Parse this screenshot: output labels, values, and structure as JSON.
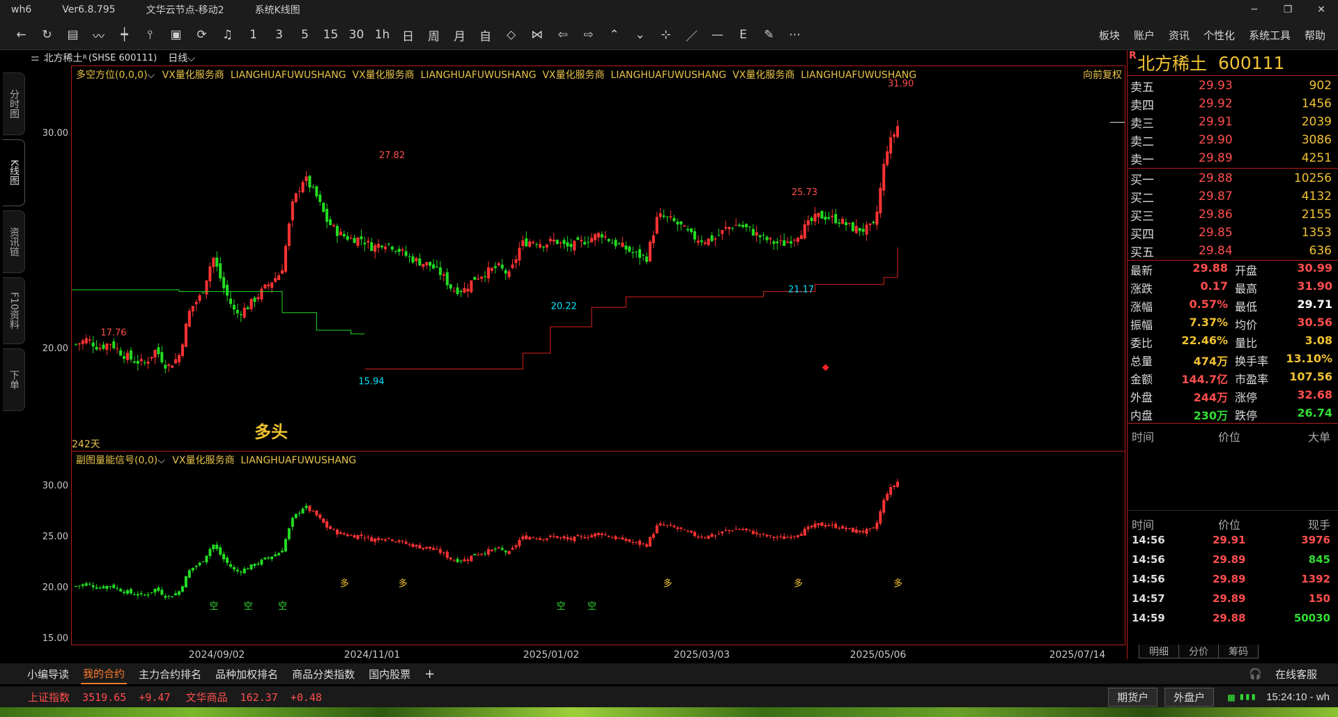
{
  "window": {
    "app": "wh6",
    "version": "Ver6.8.795",
    "node": "文华云节点-移动2",
    "view": "系统K线图",
    "controls": [
      "─",
      "❐",
      "✕"
    ]
  },
  "toolbar": {
    "icons": [
      {
        "name": "back-icon",
        "glyph": "←"
      },
      {
        "name": "refresh-icon",
        "glyph": "↻"
      },
      {
        "name": "table-icon",
        "glyph": "▤"
      },
      {
        "name": "line-chart-icon",
        "glyph": "〰"
      },
      {
        "name": "kline-icon",
        "glyph": "┿"
      },
      {
        "name": "candle-icon",
        "glyph": "⫯"
      },
      {
        "name": "screen-icon",
        "glyph": "▣"
      },
      {
        "name": "flash-icon",
        "glyph": "⟳"
      },
      {
        "name": "bell-icon",
        "glyph": "♫"
      },
      {
        "name": "period-1m",
        "glyph": "1"
      },
      {
        "name": "period-3m",
        "glyph": "3"
      },
      {
        "name": "period-5m",
        "glyph": "5"
      },
      {
        "name": "period-15m",
        "glyph": "15"
      },
      {
        "name": "period-30m",
        "glyph": "30"
      },
      {
        "name": "period-1h",
        "glyph": "1h"
      },
      {
        "name": "period-day",
        "glyph": "日"
      },
      {
        "name": "period-week",
        "glyph": "周"
      },
      {
        "name": "period-month",
        "glyph": "月"
      },
      {
        "name": "period-custom",
        "glyph": "自"
      },
      {
        "name": "expand-h-icon",
        "glyph": "◇"
      },
      {
        "name": "shrink-h-icon",
        "glyph": "⋈"
      },
      {
        "name": "left-arrow-icon",
        "glyph": "⇦"
      },
      {
        "name": "right-arrow-icon",
        "glyph": "⇨"
      },
      {
        "name": "up-icon",
        "glyph": "⌃"
      },
      {
        "name": "down-icon",
        "glyph": "⌄"
      },
      {
        "name": "crosshair-icon",
        "glyph": "⊹"
      },
      {
        "name": "ray-icon",
        "glyph": "／"
      },
      {
        "name": "hline-icon",
        "glyph": "—"
      },
      {
        "name": "fib-icon",
        "glyph": "Ε"
      },
      {
        "name": "eraser-icon",
        "glyph": "✎"
      },
      {
        "name": "more-icon",
        "glyph": "⋯"
      }
    ],
    "menu": [
      "板块",
      "账户",
      "资讯",
      "个性化",
      "系统工具",
      "帮助"
    ]
  },
  "sidetabs": [
    "分时图",
    "K线图",
    "资讯链",
    "F10资料",
    "下单"
  ],
  "info": {
    "symbol": "北方稀土",
    "code": "(SHSE 600111)",
    "period": "日线",
    "rbadge": "R"
  },
  "main_indicator": {
    "title": "多空方位(0,0,0)",
    "ad": "VX量化服务商  LIANGHUAFUWUSHANG  VX量化服务商  LIANGHUAFUWUSHANG  VX量化服务商  LIANGHUAFUWUSHANG  VX量化服务商  LIANGHUAFUWUSHANG",
    "adjust": "向前复权",
    "days": "242天",
    "signal_text": "多头"
  },
  "sub_indicator": {
    "title": "副图量能信号(0,0)",
    "ad": "VX量化服务商  LIANGHUAFUWUSHANG"
  },
  "chart_data": {
    "type": "candlestick",
    "main_y_ticks": [
      "30.00",
      "20.00"
    ],
    "sub_y_ticks": [
      "30.00",
      "25.00",
      "20.00",
      "15.00"
    ],
    "x_ticks": [
      "2024/09/02",
      "2024/11/01",
      "2025/01/02",
      "2025/03/03",
      "2025/05/06",
      "2025/07/14"
    ],
    "annotations": [
      {
        "label": "17.76",
        "color": "#ff4e4e"
      },
      {
        "label": "15.94",
        "color": "#00e5ff"
      },
      {
        "label": "27.82",
        "color": "#ff4e4e"
      },
      {
        "label": "20.22",
        "color": "#00e5ff"
      },
      {
        "label": "25.73",
        "color": "#ff4e4e"
      },
      {
        "label": "21.17",
        "color": "#00e5ff"
      },
      {
        "label": "31.90",
        "color": "#ff4e4e"
      }
    ],
    "series_close_approx": [
      17.5,
      17.8,
      17.3,
      17.6,
      17.0,
      16.6,
      16.4,
      17.2,
      16.2,
      16.8,
      19.5,
      20.3,
      22.5,
      20.6,
      19.2,
      19.6,
      20.3,
      21.0,
      21.6,
      25.5,
      27.0,
      26.0,
      24.5,
      23.8,
      23.5,
      23.5,
      23.0,
      23.3,
      23.0,
      22.5,
      22.2,
      22.0,
      21.5,
      20.6,
      20.6,
      21.3,
      21.6,
      21.9,
      21.4,
      23.2,
      23.4,
      23.2,
      23.4,
      23.0,
      23.2,
      23.5,
      23.8,
      23.3,
      23.0,
      22.6,
      22.4,
      24.8,
      24.6,
      24.2,
      23.6,
      23.4,
      23.5,
      24.1,
      24.3,
      24.0,
      23.6,
      23.3,
      23.2,
      23.6,
      24.2,
      24.8,
      24.7,
      24.5,
      24.1,
      24.0,
      24.2,
      28.5,
      29.88
    ]
  },
  "quote": {
    "name": "北方稀土",
    "code": "600111",
    "rbadge": "R",
    "asks": [
      {
        "label": "卖五",
        "price": "29.93",
        "vol": "902"
      },
      {
        "label": "卖四",
        "price": "29.92",
        "vol": "1456"
      },
      {
        "label": "卖三",
        "price": "29.91",
        "vol": "2039"
      },
      {
        "label": "卖二",
        "price": "29.90",
        "vol": "3086"
      },
      {
        "label": "卖一",
        "price": "29.89",
        "vol": "4251"
      }
    ],
    "bids": [
      {
        "label": "买一",
        "price": "29.88",
        "vol": "10256"
      },
      {
        "label": "买二",
        "price": "29.87",
        "vol": "4132"
      },
      {
        "label": "买三",
        "price": "29.86",
        "vol": "2155"
      },
      {
        "label": "买四",
        "price": "29.85",
        "vol": "1353"
      },
      {
        "label": "买五",
        "price": "29.84",
        "vol": "636"
      }
    ],
    "stats": [
      [
        {
          "k": "最新",
          "v": "29.88",
          "c": "#ff4e4e"
        },
        {
          "k": "开盘",
          "v": "30.99",
          "c": "#ff4e4e"
        }
      ],
      [
        {
          "k": "涨跌",
          "v": "0.17",
          "c": "#ff4e4e"
        },
        {
          "k": "最高",
          "v": "31.90",
          "c": "#ff4e4e"
        }
      ],
      [
        {
          "k": "涨幅",
          "v": "0.57%",
          "c": "#ff4e4e"
        },
        {
          "k": "最低",
          "v": "29.71",
          "c": "#ffffff"
        }
      ],
      [
        {
          "k": "振幅",
          "v": "7.37%",
          "c": "#f1c232"
        },
        {
          "k": "均价",
          "v": "30.56",
          "c": "#ff4e4e"
        }
      ],
      [
        {
          "k": "委比",
          "v": "22.46%",
          "c": "#f1c232"
        },
        {
          "k": "量比",
          "v": "3.08",
          "c": "#f1c232"
        }
      ],
      [
        {
          "k": "总量",
          "v": "474万",
          "c": "#f1c232"
        },
        {
          "k": "换手率",
          "v": "13.10%",
          "c": "#f1c232"
        }
      ],
      [
        {
          "k": "金额",
          "v": "144.7亿",
          "c": "#ff4e4e"
        },
        {
          "k": "市盈率",
          "v": "107.56",
          "c": "#f1c232"
        }
      ],
      [
        {
          "k": "外盘",
          "v": "244万",
          "c": "#ff4e4e"
        },
        {
          "k": "涨停",
          "v": "32.68",
          "c": "#ff4e4e"
        }
      ],
      [
        {
          "k": "内盘",
          "v": "230万",
          "c": "#33dd33"
        },
        {
          "k": "跌停",
          "v": "26.74",
          "c": "#33dd33"
        }
      ]
    ],
    "big_head": [
      "时间",
      "价位",
      "大单"
    ],
    "tick_head": [
      "时间",
      "价位",
      "现手"
    ],
    "ticks": [
      {
        "t": "14:56",
        "p": "29.91",
        "v": "3976",
        "vc": "#ff4e4e"
      },
      {
        "t": "14:56",
        "p": "29.89",
        "v": "845",
        "vc": "#33dd33"
      },
      {
        "t": "14:56",
        "p": "29.89",
        "v": "1392",
        "vc": "#ff4e4e"
      },
      {
        "t": "14:57",
        "p": "29.89",
        "v": "150",
        "vc": "#ff4e4e"
      },
      {
        "t": "14:59",
        "p": "29.88",
        "v": "50030",
        "vc": "#33dd33"
      }
    ],
    "tabs": [
      "明细",
      "分价",
      "筹码"
    ]
  },
  "bottom_tabs": [
    "小编导读",
    "我的合约",
    "主力合约排名",
    "品种加权排名",
    "商品分类指数",
    "国内股票"
  ],
  "bottom_active": 1,
  "add_tab": "+",
  "kefu": "在线客服",
  "status": {
    "index1": "上证指数  3519.65  +9.47",
    "index2": "文华商品  162.37  +0.48",
    "btn1": "期货户",
    "btn2": "外盘户",
    "clock": "15:24:10 - wh"
  },
  "colors": {
    "up": "#ff3333",
    "down": "#22dd22",
    "border": "#b51c1c",
    "accent": "#f1c232"
  }
}
